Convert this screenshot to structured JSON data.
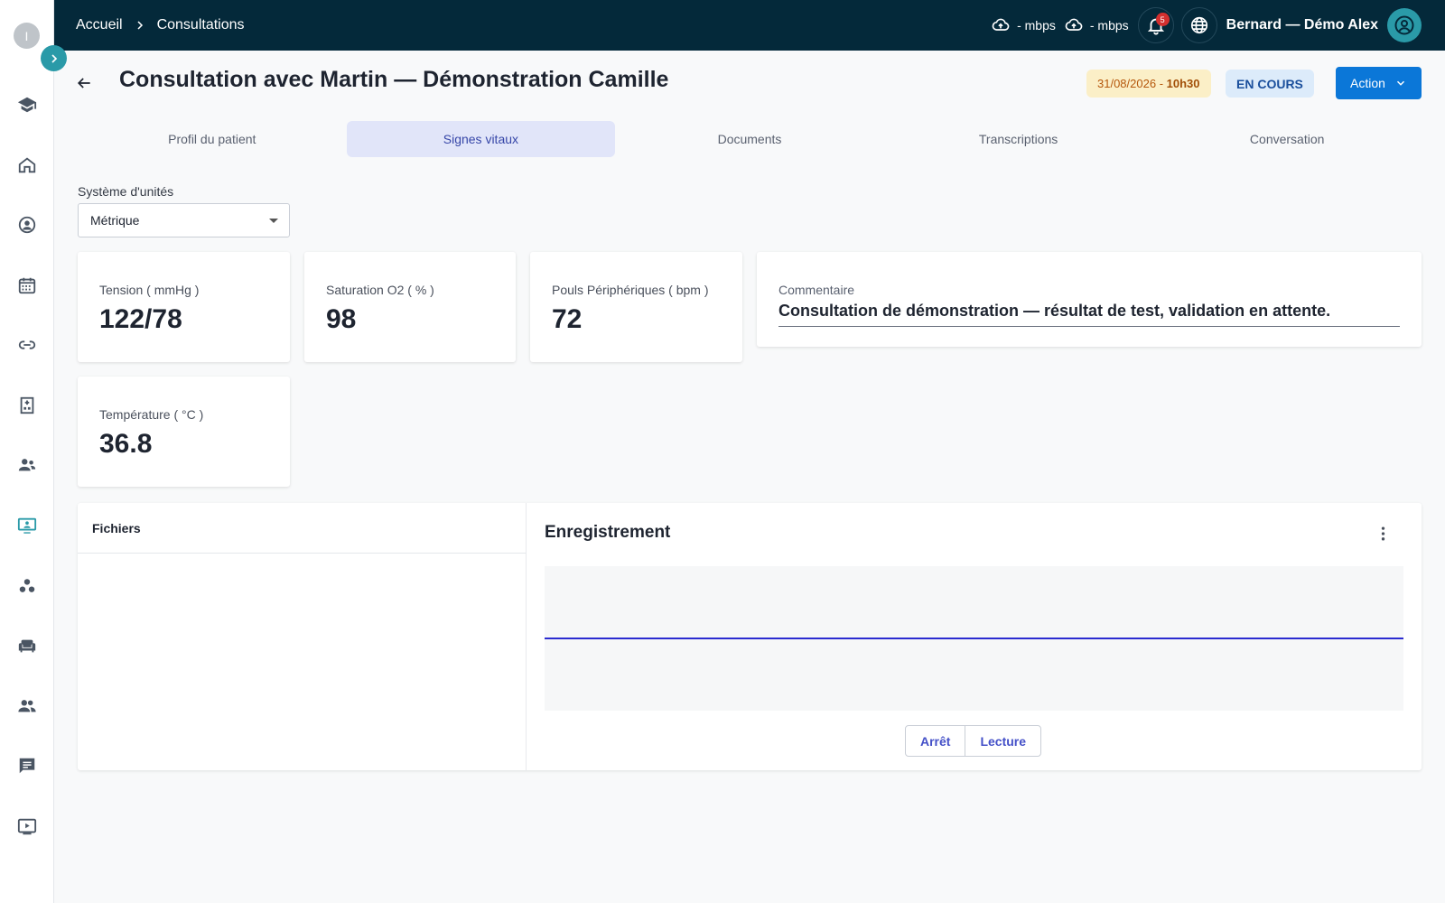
{
  "sidebar": {
    "avatar_initial": "I",
    "items": [
      {
        "icon": "graduation-cap-icon"
      },
      {
        "icon": "home-icon"
      },
      {
        "icon": "doctor-icon"
      },
      {
        "icon": "calendar-icon"
      },
      {
        "icon": "link-icon"
      },
      {
        "icon": "hospital-icon"
      },
      {
        "icon": "user-group-icon"
      },
      {
        "icon": "teleconsultation-icon",
        "active": true
      },
      {
        "icon": "bubbles-icon"
      },
      {
        "icon": "sofa-icon"
      },
      {
        "icon": "people-icon"
      },
      {
        "icon": "chat-icon"
      },
      {
        "icon": "video-icon"
      }
    ]
  },
  "topbar": {
    "breadcrumb": [
      "Accueil",
      "Consultations"
    ],
    "network": [
      {
        "icon": "cloud-upload-icon",
        "label": "- mbps"
      },
      {
        "icon": "cloud-upload-icon",
        "label": "- mbps"
      }
    ],
    "notifications_count": "5",
    "user_name": "Bernard — Démo Alex"
  },
  "header": {
    "title": "Consultation avec Martin — Démonstration Camille",
    "date": "31/08/2026",
    "date_sep": " - ",
    "time": "10h30",
    "status": "EN COURS",
    "action_label": "Action"
  },
  "tabs": [
    {
      "label": "Profil du patient",
      "active": false
    },
    {
      "label": "Signes vitaux",
      "active": true
    },
    {
      "label": "Documents",
      "active": false
    },
    {
      "label": "Transcriptions",
      "active": false
    },
    {
      "label": "Conversation",
      "active": false
    }
  ],
  "units": {
    "label": "Système d'unités",
    "value": "Métrique"
  },
  "vitals": [
    {
      "label": "Tension ( mmHg )",
      "value": "122/78"
    },
    {
      "label": "Saturation O2 ( % )",
      "value": "98"
    },
    {
      "label": "Pouls Périphériques ( bpm )",
      "value": "72"
    },
    {
      "label": "Température ( °C )",
      "value": "36.8"
    }
  ],
  "comment": {
    "label": "Commentaire",
    "text": "Consultation de démonstration — résultat de test, validation en attente."
  },
  "files": {
    "title": "Fichiers"
  },
  "recording": {
    "title": "Enregistrement",
    "stop_label": "Arrêt",
    "play_label": "Lecture"
  },
  "colors": {
    "topbar_bg": "#04293a",
    "accent": "#2a9aa8",
    "action_button": "#0b77d8",
    "status_badge_bg": "#dcebfa",
    "date_badge_bg": "#fbefc7",
    "active_tab_bg": "#e1e5f9",
    "waveform_line": "#2b2bd0"
  }
}
